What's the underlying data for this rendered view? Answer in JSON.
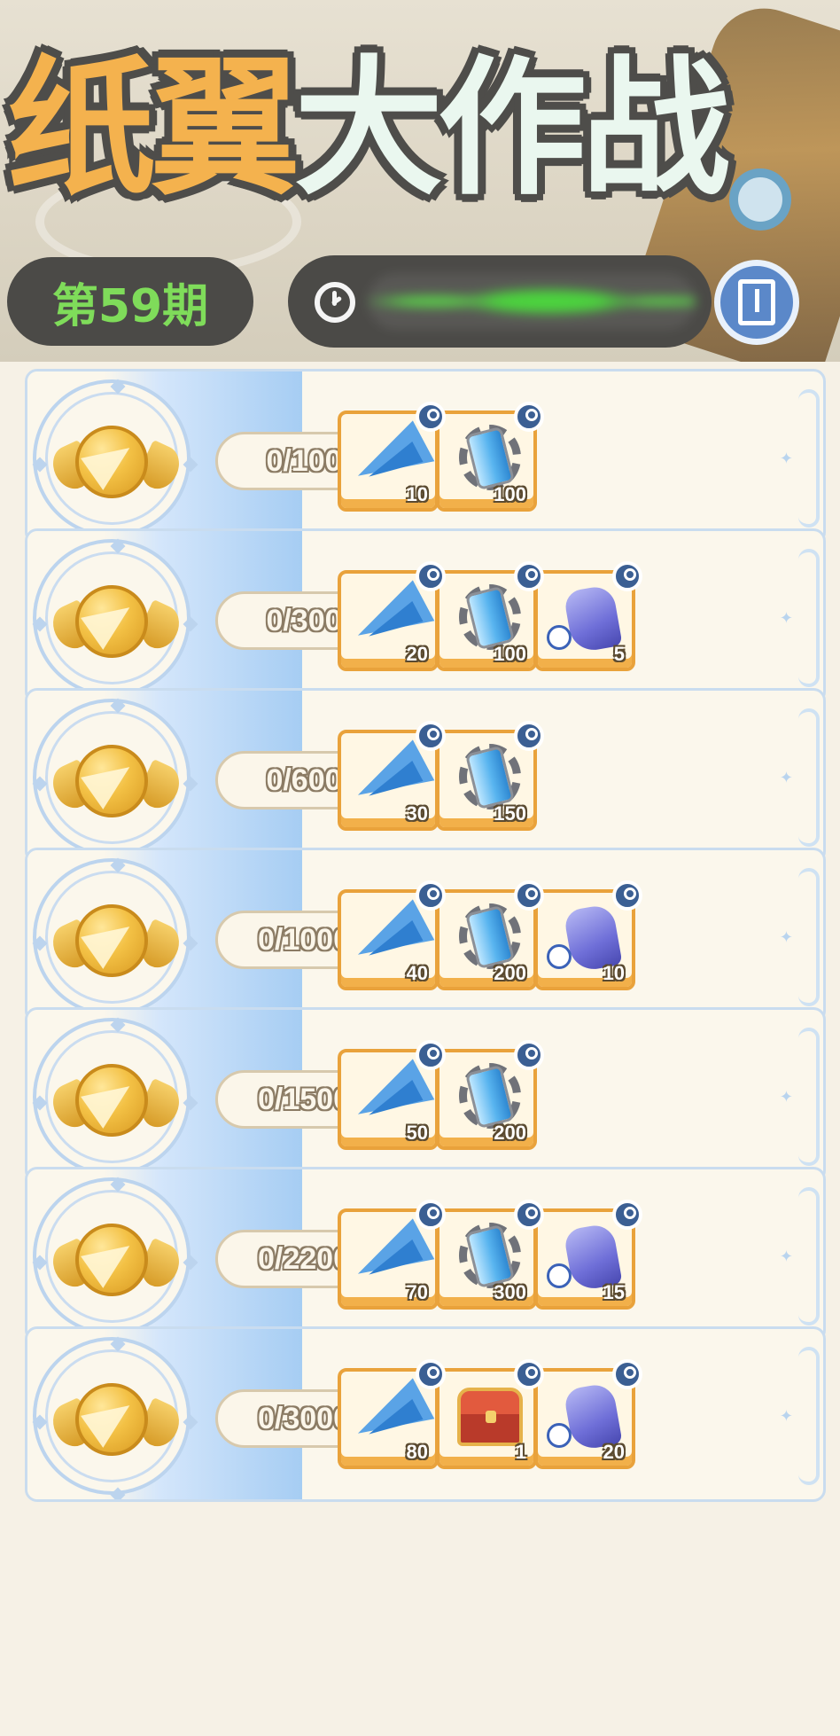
{
  "header": {
    "title_part1": "纸翼",
    "title_part2": "大作战",
    "period_label": "第59期"
  },
  "icons": {
    "clock": "clock-icon",
    "guide": "book-icon",
    "medal": "gold-wing-medal-icon",
    "lock": "lock-icon",
    "items": {
      "plane": "paper-plane-icon",
      "canister": "energy-canister-icon",
      "ghost": "purple-spirit-icon",
      "chest": "treasure-chest-icon"
    }
  },
  "colors": {
    "title_orange": "#f4b24e",
    "title_mint": "#eaf7ef",
    "period_green": "#7fdc5a",
    "pill_dark": "#4b4a47",
    "row_border": "#c9dcef",
    "reward_frame": "#e9a23b",
    "lock_blue": "#3b5f93"
  },
  "tiers": [
    {
      "progress": "0/100",
      "rewards": [
        {
          "item": "plane",
          "qty": "10"
        },
        {
          "item": "canister",
          "qty": "100"
        }
      ]
    },
    {
      "progress": "0/300",
      "rewards": [
        {
          "item": "plane",
          "qty": "20"
        },
        {
          "item": "canister",
          "qty": "100"
        },
        {
          "item": "ghost",
          "qty": "5"
        }
      ]
    },
    {
      "progress": "0/600",
      "rewards": [
        {
          "item": "plane",
          "qty": "30"
        },
        {
          "item": "canister",
          "qty": "150"
        }
      ]
    },
    {
      "progress": "0/1000",
      "rewards": [
        {
          "item": "plane",
          "qty": "40"
        },
        {
          "item": "canister",
          "qty": "200"
        },
        {
          "item": "ghost",
          "qty": "10"
        }
      ]
    },
    {
      "progress": "0/1500",
      "rewards": [
        {
          "item": "plane",
          "qty": "50"
        },
        {
          "item": "canister",
          "qty": "200"
        }
      ]
    },
    {
      "progress": "0/2200",
      "rewards": [
        {
          "item": "plane",
          "qty": "70"
        },
        {
          "item": "canister",
          "qty": "300"
        },
        {
          "item": "ghost",
          "qty": "15"
        }
      ]
    },
    {
      "progress": "0/3000",
      "rewards": [
        {
          "item": "plane",
          "qty": "80"
        },
        {
          "item": "chest",
          "qty": "1"
        },
        {
          "item": "ghost",
          "qty": "20"
        }
      ]
    }
  ]
}
